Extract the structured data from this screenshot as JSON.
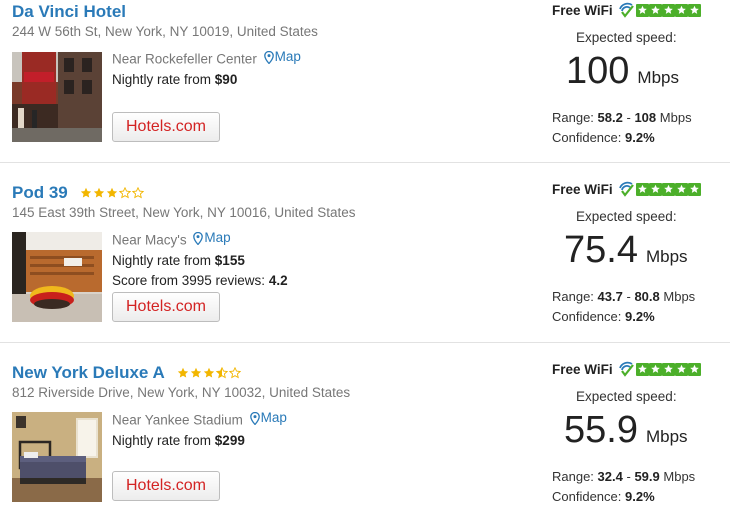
{
  "listings": [
    {
      "name": "Da Vinci Hotel",
      "stars": 0,
      "address": "244 W 56th St, New York, NY 10019, United States",
      "near": "Near Rockefeller Center",
      "map_label": "Map",
      "rate_label": "Nightly rate from",
      "rate": "$90",
      "reviews_label": "",
      "reviews_score": "",
      "button_label": "Hotels.com",
      "wifi_label": "Free WiFi",
      "wifi_rating": 5,
      "expected_label": "Expected speed:",
      "speed": "100",
      "speed_unit": "Mbps",
      "range_label": "Range:",
      "range_low": "58.2",
      "range_sep": "-",
      "range_high": "108",
      "range_unit": "Mbps",
      "confidence_label": "Confidence:",
      "confidence": "9.2%"
    },
    {
      "name": "Pod 39",
      "stars": 3,
      "address": "145 East 39th Street, New York, NY 10016, United States",
      "near": "Near Macy's",
      "map_label": "Map",
      "rate_label": "Nightly rate from",
      "rate": "$155",
      "reviews_label": "Score from 3995 reviews:",
      "reviews_score": "4.2",
      "button_label": "Hotels.com",
      "wifi_label": "Free WiFi",
      "wifi_rating": 5,
      "expected_label": "Expected speed:",
      "speed": "75.4",
      "speed_unit": "Mbps",
      "range_label": "Range:",
      "range_low": "43.7",
      "range_sep": "-",
      "range_high": "80.8",
      "range_unit": "Mbps",
      "confidence_label": "Confidence:",
      "confidence": "9.2%"
    },
    {
      "name": "New York Deluxe A",
      "stars": 3.5,
      "address": "812 Riverside Drive, New York, NY 10032, United States",
      "near": "Near Yankee Stadium",
      "map_label": "Map",
      "rate_label": "Nightly rate from",
      "rate": "$299",
      "reviews_label": "",
      "reviews_score": "",
      "button_label": "Hotels.com",
      "wifi_label": "Free WiFi",
      "wifi_rating": 5,
      "expected_label": "Expected speed:",
      "speed": "55.9",
      "speed_unit": "Mbps",
      "range_label": "Range:",
      "range_low": "32.4",
      "range_sep": "-",
      "range_high": "59.9",
      "range_unit": "Mbps",
      "confidence_label": "Confidence:",
      "confidence": "9.2%"
    }
  ],
  "colors": {
    "link": "#2a7ab8",
    "star_gold": "#f2b600",
    "wifi_green": "#4caf2a",
    "brand_red": "#d32323"
  },
  "icons": {
    "map": "map-pin-icon",
    "wifi": "wifi-check-icon",
    "rating": "star-icon"
  }
}
